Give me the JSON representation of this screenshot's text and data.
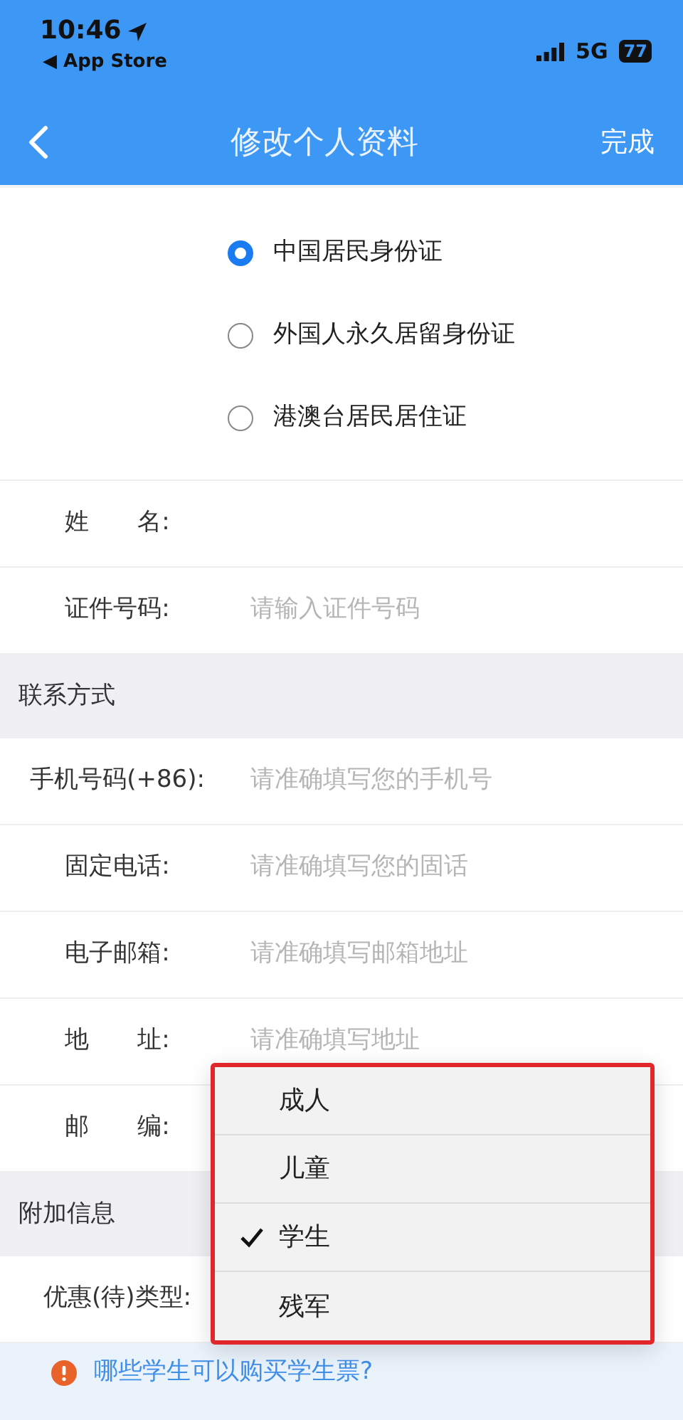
{
  "status_bar": {
    "time": "10:46",
    "back_app": "◀ App Store",
    "network": "5G",
    "battery": "77"
  },
  "nav": {
    "title": "修改个人资料",
    "action": "完成"
  },
  "id_types": [
    {
      "label": "中国居民身份证",
      "selected": true
    },
    {
      "label": "外国人永久居留身份证",
      "selected": false
    },
    {
      "label": "港澳台居民居住证",
      "selected": false
    }
  ],
  "identity_fields": [
    {
      "label": "姓　　名:"
    },
    {
      "label": "证件号码:",
      "placeholder": "请输入证件号码"
    }
  ],
  "sections": [
    {
      "title": "联系方式",
      "fields": [
        {
          "label": "手机号码(+86):",
          "placeholder": "请准确填写您的手机号"
        },
        {
          "label": "固定电话:",
          "placeholder": "请准确填写您的固话"
        },
        {
          "label": "电子邮箱:",
          "placeholder": "请准确填写邮箱地址"
        },
        {
          "label": "地　　址:",
          "placeholder": "请准确填写地址"
        },
        {
          "label": "邮　　编:"
        }
      ]
    },
    {
      "title": "附加信息",
      "fields": [
        {
          "label": "优惠(待)类型:"
        }
      ]
    }
  ],
  "help_link": "哪些学生可以购买学生票?",
  "discount_menu": {
    "options": [
      {
        "label": "成人",
        "selected": false
      },
      {
        "label": "儿童",
        "selected": false
      },
      {
        "label": "学生",
        "selected": true
      },
      {
        "label": "残军",
        "selected": false
      }
    ]
  }
}
